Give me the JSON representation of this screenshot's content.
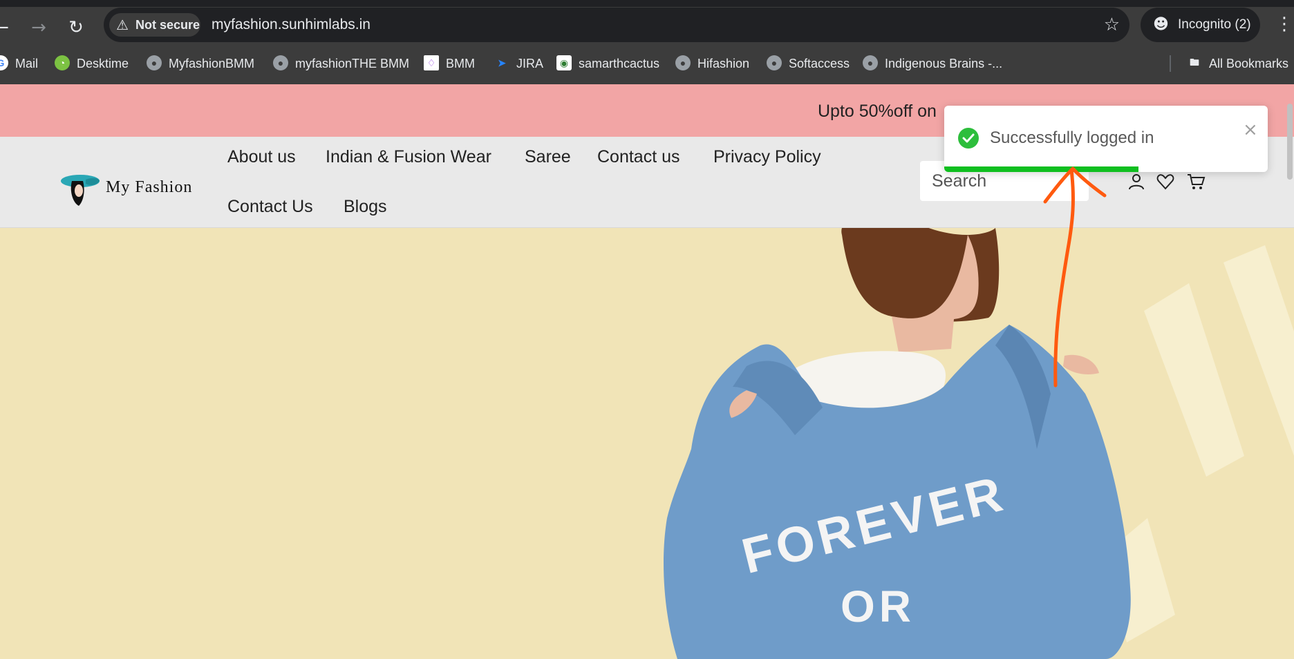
{
  "browser": {
    "security_label": "Not secure",
    "url": "myfashion.sunhimlabs.in",
    "incognito_label": "Incognito (2)",
    "icons": [
      "back-arrow-icon",
      "forward-arrow-icon",
      "reload-icon",
      "warning-icon",
      "star-icon",
      "incognito-icon",
      "kebab-menu-icon"
    ],
    "bookmarks": [
      {
        "label": "Mail",
        "icon": "google-icon"
      },
      {
        "label": "Desktime",
        "icon": "desktime-icon"
      },
      {
        "label": "MyfashionBMM",
        "icon": "globe-icon"
      },
      {
        "label": "myfashionTHE BMM",
        "icon": "globe-icon"
      },
      {
        "label": "BMM",
        "icon": "bmm-icon"
      },
      {
        "label": "JIRA",
        "icon": "jira-icon"
      },
      {
        "label": "samarthcactus",
        "icon": "cactus-icon"
      },
      {
        "label": "Hifashion",
        "icon": "globe-icon"
      },
      {
        "label": "Softaccess",
        "icon": "globe-icon"
      },
      {
        "label": "Indigenous Brains -...",
        "icon": "globe-icon"
      }
    ],
    "all_bookmarks_label": "All Bookmarks"
  },
  "promo": {
    "text": "Upto 50%off on "
  },
  "header": {
    "logo_text_my": "My",
    "logo_text_fashion": "Fashion",
    "nav": [
      "About us",
      "Indian & Fusion Wear",
      "Saree",
      "Contact us",
      "Privacy Policy",
      "Contact Us",
      "Blogs"
    ],
    "search_placeholder": "Search",
    "icons": [
      "user-icon",
      "heart-icon",
      "cart-icon"
    ]
  },
  "hero": {
    "jacket_text_line1": "FOREVER",
    "jacket_text_line2": "OR"
  },
  "toast": {
    "message": "Successfully logged in",
    "close_symbol": "×",
    "progress_fraction": 0.6
  },
  "colors": {
    "promo_bg": "#f2a5a5",
    "header_bg": "#e9e9e9",
    "hero_bg": "#f1e4b7",
    "toast_progress": "#0fbf1f",
    "annotation_arrow": "#ff5a0f",
    "logo_teal": "#2aa7b5"
  }
}
